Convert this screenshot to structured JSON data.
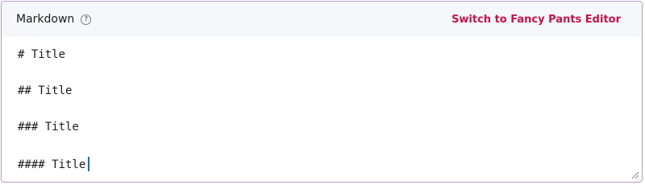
{
  "editor": {
    "mode_label": "Markdown",
    "help_icon": "help-circle-icon",
    "switch_link": "Switch to Fancy Pants Editor",
    "lines": [
      "# Title",
      "## Title",
      "### Title",
      "#### Title"
    ]
  },
  "colors": {
    "border": "#b99ad0",
    "header_bg": "#f6f7f8",
    "link": "#c8124a",
    "caret": "#0a74c6"
  }
}
